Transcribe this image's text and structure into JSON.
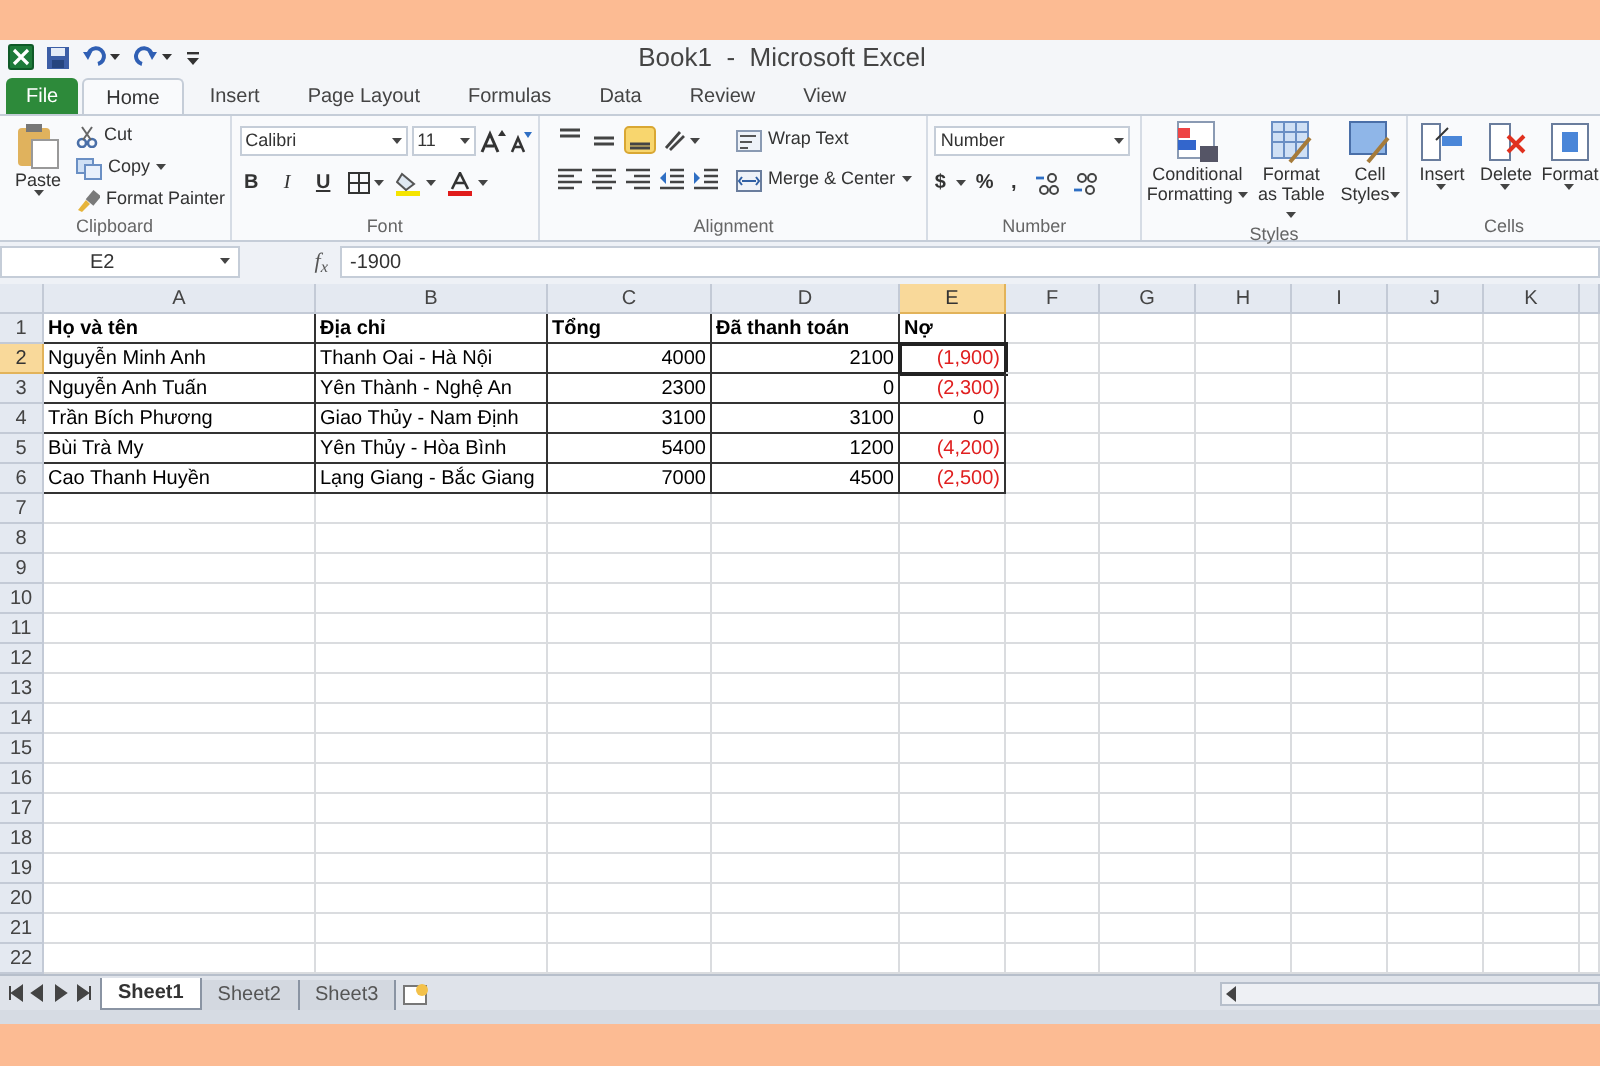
{
  "window": {
    "title": "Book1  -  Microsoft Excel"
  },
  "ribbon_tabs": [
    {
      "label": "File",
      "kind": "file",
      "selected": false
    },
    {
      "label": "Home",
      "kind": "tab",
      "selected": true
    },
    {
      "label": "Insert",
      "kind": "tab",
      "selected": false
    },
    {
      "label": "Page Layout",
      "kind": "tab",
      "selected": false
    },
    {
      "label": "Formulas",
      "kind": "tab",
      "selected": false
    },
    {
      "label": "Data",
      "kind": "tab",
      "selected": false
    },
    {
      "label": "Review",
      "kind": "tab",
      "selected": false
    },
    {
      "label": "View",
      "kind": "tab",
      "selected": false
    }
  ],
  "clipboard": {
    "paste": "Paste",
    "cut": "Cut",
    "copy": "Copy",
    "format_painter": "Format Painter",
    "label": "Clipboard"
  },
  "font": {
    "family": "Calibri",
    "size": "11",
    "bold": "B",
    "italic": "I",
    "underline": "U",
    "label": "Font"
  },
  "alignment": {
    "wrap_text": "Wrap Text",
    "merge": "Merge & Center",
    "label": "Alignment"
  },
  "number": {
    "format": "Number",
    "currency": "$",
    "percent": "%",
    "comma": ",",
    "label": "Number"
  },
  "styles": {
    "conditional": "Conditional Formatting",
    "format_table": "Format as Table",
    "cell_styles": "Cell Styles",
    "label": "Styles"
  },
  "cells": {
    "insert": "Insert",
    "delete": "Delete",
    "format": "Format",
    "label": "Cells"
  },
  "formula_bar": {
    "name_box": "E2",
    "fx": "f$_{x}$",
    "formula": "-1900"
  },
  "columns": [
    {
      "label": "A",
      "selected": false
    },
    {
      "label": "B",
      "selected": false
    },
    {
      "label": "C",
      "selected": false
    },
    {
      "label": "D",
      "selected": false
    },
    {
      "label": "E",
      "selected": true
    },
    {
      "label": "F",
      "selected": false
    },
    {
      "label": "G",
      "selected": false
    },
    {
      "label": "H",
      "selected": false
    },
    {
      "label": "I",
      "selected": false
    },
    {
      "label": "J",
      "selected": false
    },
    {
      "label": "K",
      "selected": false
    }
  ],
  "rows": [
    {
      "number": "1",
      "selected": false,
      "cells": [
        {
          "text": "Họ và tên",
          "kind": "header"
        },
        {
          "text": "Địa chỉ",
          "kind": "header"
        },
        {
          "text": "Tổng",
          "kind": "header"
        },
        {
          "text": "Đã thanh toán",
          "kind": "header"
        },
        {
          "text": "Nợ",
          "kind": "header"
        }
      ]
    },
    {
      "number": "2",
      "selected": true,
      "cells": [
        {
          "text": "Nguyễn Minh Anh",
          "kind": "text"
        },
        {
          "text": "Thanh Oai - Hà Nội",
          "kind": "text"
        },
        {
          "text": "4000",
          "kind": "number"
        },
        {
          "text": "2100",
          "kind": "number"
        },
        {
          "text": "(1,900)",
          "kind": "negative"
        }
      ]
    },
    {
      "number": "3",
      "selected": false,
      "cells": [
        {
          "text": "Nguyễn Anh Tuấn",
          "kind": "text"
        },
        {
          "text": "Yên Thành - Nghệ An",
          "kind": "text"
        },
        {
          "text": "2300",
          "kind": "number"
        },
        {
          "text": "0",
          "kind": "number"
        },
        {
          "text": "(2,300)",
          "kind": "negative"
        }
      ]
    },
    {
      "number": "4",
      "selected": false,
      "cells": [
        {
          "text": "Trần Bích Phương",
          "kind": "text"
        },
        {
          "text": "Giao Thủy - Nam Định",
          "kind": "text"
        },
        {
          "text": "3100",
          "kind": "number"
        },
        {
          "text": "3100",
          "kind": "number"
        },
        {
          "text": "0",
          "kind": "zero"
        }
      ]
    },
    {
      "number": "5",
      "selected": false,
      "cells": [
        {
          "text": "Bùi Trà My",
          "kind": "text"
        },
        {
          "text": "Yên Thủy - Hòa Bình",
          "kind": "text"
        },
        {
          "text": "5400",
          "kind": "number"
        },
        {
          "text": "1200",
          "kind": "number"
        },
        {
          "text": "(4,200)",
          "kind": "negative"
        }
      ]
    },
    {
      "number": "6",
      "selected": false,
      "cells": [
        {
          "text": "Cao Thanh Huyền",
          "kind": "text"
        },
        {
          "text": "Lạng Giang - Bắc Giang",
          "kind": "text"
        },
        {
          "text": "7000",
          "kind": "number"
        },
        {
          "text": "4500",
          "kind": "number"
        },
        {
          "text": "(2,500)",
          "kind": "negative"
        }
      ]
    },
    {
      "number": "7",
      "selected": false
    },
    {
      "number": "8",
      "selected": false
    },
    {
      "number": "9",
      "selected": false
    },
    {
      "number": "10",
      "selected": false
    },
    {
      "number": "11",
      "selected": false
    },
    {
      "number": "12",
      "selected": false
    },
    {
      "number": "13",
      "selected": false
    },
    {
      "number": "14",
      "selected": false
    },
    {
      "number": "15",
      "selected": false
    },
    {
      "number": "16",
      "selected": false
    },
    {
      "number": "17",
      "selected": false
    },
    {
      "number": "18",
      "selected": false
    },
    {
      "number": "19",
      "selected": false
    },
    {
      "number": "20",
      "selected": false
    },
    {
      "number": "21",
      "selected": false
    },
    {
      "number": "22",
      "selected": false
    }
  ],
  "sheet_tabs": [
    {
      "label": "Sheet1",
      "selected": true
    },
    {
      "label": "Sheet2",
      "selected": false
    },
    {
      "label": "Sheet3",
      "selected": false
    }
  ]
}
